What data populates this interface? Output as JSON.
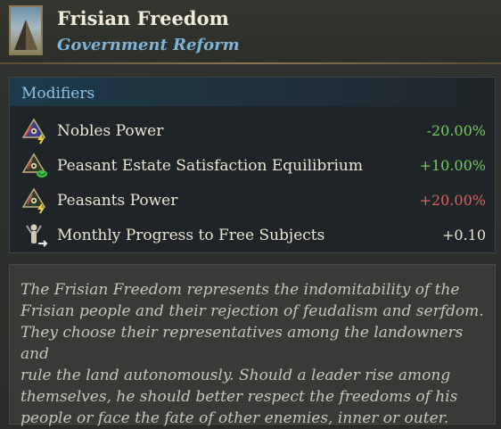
{
  "header": {
    "title": "Frisian Freedom",
    "subtitle": "Government Reform",
    "portrait_icon": "pyramid-portrait-icon"
  },
  "modifiers": {
    "heading": "Modifiers",
    "items": [
      {
        "label": "Nobles Power",
        "value": "-20.00%",
        "color": "#6fcf5a",
        "icon": "nobles-power-icon"
      },
      {
        "label": "Peasant Estate Satisfaction Equilibrium",
        "value": "+10.00%",
        "color": "#6fcf5a",
        "icon": "peasant-satisfaction-icon"
      },
      {
        "label": "Peasants Power",
        "value": "+20.00%",
        "color": "#e0605a",
        "icon": "peasants-power-icon"
      },
      {
        "label": "Monthly Progress to Free Subjects",
        "value": "+0.10",
        "color": "#ece6d4",
        "icon": "free-subjects-icon"
      }
    ]
  },
  "description": "The Frisian Freedom represents the indomitability of the\nFrisian people and their rejection of feudalism and serfdom.\nThey choose their representatives among the landowners and\nrule the land autonomously. Should a leader rise among\nthemselves, he should better respect the freedoms of his\npeople or face the fate of other enemies, inner or outer."
}
